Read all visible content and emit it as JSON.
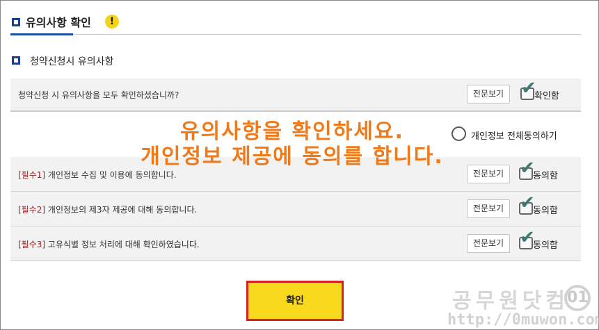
{
  "header": {
    "title": "유의사항 확인",
    "warn_glyph": "!"
  },
  "section": {
    "title": "청약신청시 유의사항"
  },
  "main_row": {
    "text": "청약신청 시 유의사항을 모두 확인하셨습니까?",
    "view_label": "전문보기",
    "check_label": "확인함"
  },
  "agree_all": {
    "label": "개인정보 전체동의하기"
  },
  "overlay": {
    "line1": "유의사항을 확인하세요.",
    "line2": "개인정보 제공에 동의를 합니다."
  },
  "requirements": [
    {
      "tag": "[필수1]",
      "text": " 개인정보 수집 및 이용에 동의합니다.",
      "view_label": "전문보기",
      "check_label": "동의함"
    },
    {
      "tag": "[필수2]",
      "text": " 개인정보의 제3자 제공에 대해 동의합니다.",
      "view_label": "전문보기",
      "check_label": "동의함"
    },
    {
      "tag": "[필수3]",
      "text": " 고유식별 정보 처리에 대해 확인하였습니다.",
      "view_label": "전문보기",
      "check_label": "동의함"
    }
  ],
  "confirm": {
    "label": "확인"
  },
  "watermark": {
    "name": "공무원닷컴",
    "logo": "01",
    "url": "http://0muwon.com"
  },
  "icons": {
    "warning": "warning-icon",
    "check": "checkmark-icon",
    "square_bullet": "square-bullet-icon",
    "radio": "radio-icon"
  },
  "colors": {
    "accent_blue": "#1a3f8f",
    "warn_yellow": "#f4d31a",
    "check_green": "#3f7a72",
    "required_red": "#a02020",
    "overlay_orange": "#f07a1a",
    "confirm_bg": "#f8d81c",
    "confirm_border": "#d82020"
  }
}
